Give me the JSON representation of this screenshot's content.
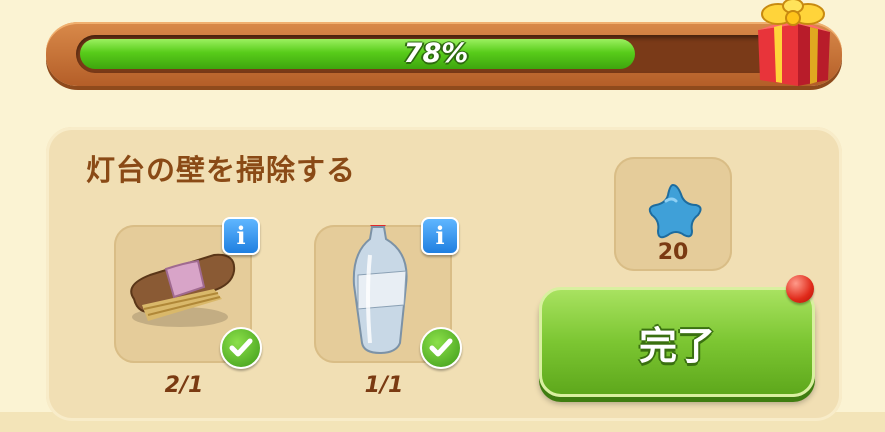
{
  "progress": {
    "percent_label": "78%",
    "fraction": 0.78
  },
  "task": {
    "title": "灯台の壁を掃除する",
    "items": [
      {
        "name": "brush",
        "count": "2/1",
        "completed": true,
        "info": "i"
      },
      {
        "name": "bottle",
        "count": "1/1",
        "completed": true,
        "info": "i"
      }
    ],
    "reward": {
      "icon": "blue-star-icon",
      "amount": "20"
    },
    "complete_button": {
      "label": "完了"
    }
  },
  "colors": {
    "progress_green": "#58cc1a",
    "frame_brown": "#b45e28",
    "button_green": "#7cc632"
  }
}
